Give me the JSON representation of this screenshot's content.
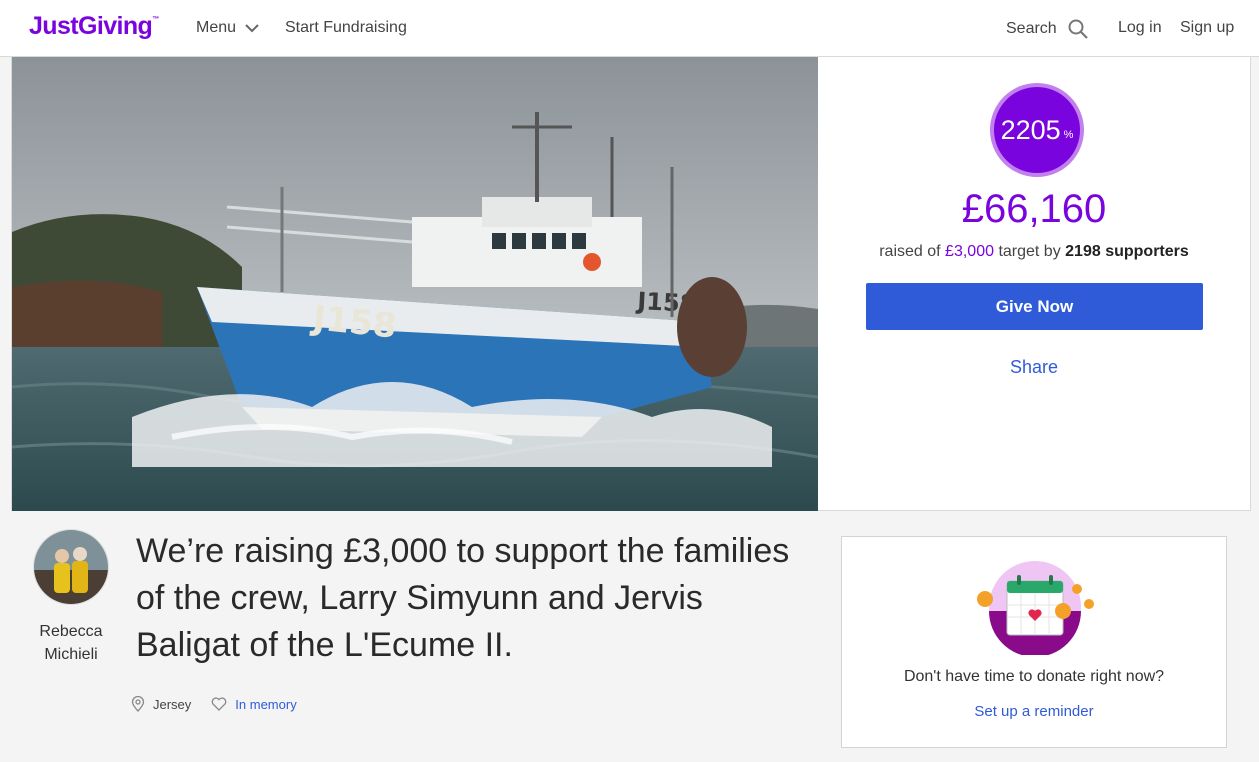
{
  "header": {
    "logo": "JustGiving",
    "logo_tm": "™",
    "menu_label": "Menu",
    "start_label": "Start Fundraising",
    "search_label": "Search",
    "login_label": "Log in",
    "signup_label": "Sign up"
  },
  "progress": {
    "percent": "2205",
    "percent_sign": "%",
    "raised": "£66,160",
    "raised_prefix": "raised of",
    "target": "£3,000",
    "target_by": "target by",
    "supporters": "2198 supporters"
  },
  "actions": {
    "give_label": "Give Now",
    "share_label": "Share"
  },
  "owner": {
    "first_name": "Rebecca",
    "last_name": "Michieli"
  },
  "page": {
    "title": "We’re raising £3,000 to support the families of the crew, Larry Simyunn and Jervis Baligat of the L'Ecume II.",
    "location": "Jersey",
    "category": "In memory"
  },
  "reminder": {
    "text": "Don't have time to donate right now?",
    "link_label": "Set up a reminder"
  },
  "colors": {
    "brand": "#7a04dd",
    "button": "#2f5bd9",
    "link": "#2f5bd9"
  }
}
